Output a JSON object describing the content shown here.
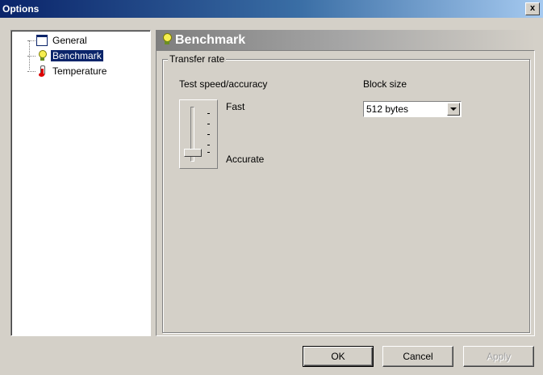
{
  "window": {
    "title": "Options",
    "close_label": "x"
  },
  "tree": {
    "items": [
      {
        "label": "General",
        "icon": "window-icon",
        "selected": false
      },
      {
        "label": "Benchmark",
        "icon": "lightbulb-icon",
        "selected": true
      },
      {
        "label": "Temperature",
        "icon": "thermometer-icon",
        "selected": false
      }
    ]
  },
  "panel": {
    "title": "Benchmark",
    "icon": "lightbulb-icon",
    "group": {
      "legend": "Transfer rate",
      "speed_label": "Test speed/accuracy",
      "fast_label": "Fast",
      "accurate_label": "Accurate",
      "block_size_label": "Block size",
      "block_size_value": "512 bytes",
      "slider_position": "Accurate"
    }
  },
  "buttons": {
    "ok": "OK",
    "cancel": "Cancel",
    "apply": "Apply"
  },
  "colors": {
    "titlebar_start": "#0a246a",
    "selection": "#0a246a",
    "face": "#d4d0c8"
  }
}
